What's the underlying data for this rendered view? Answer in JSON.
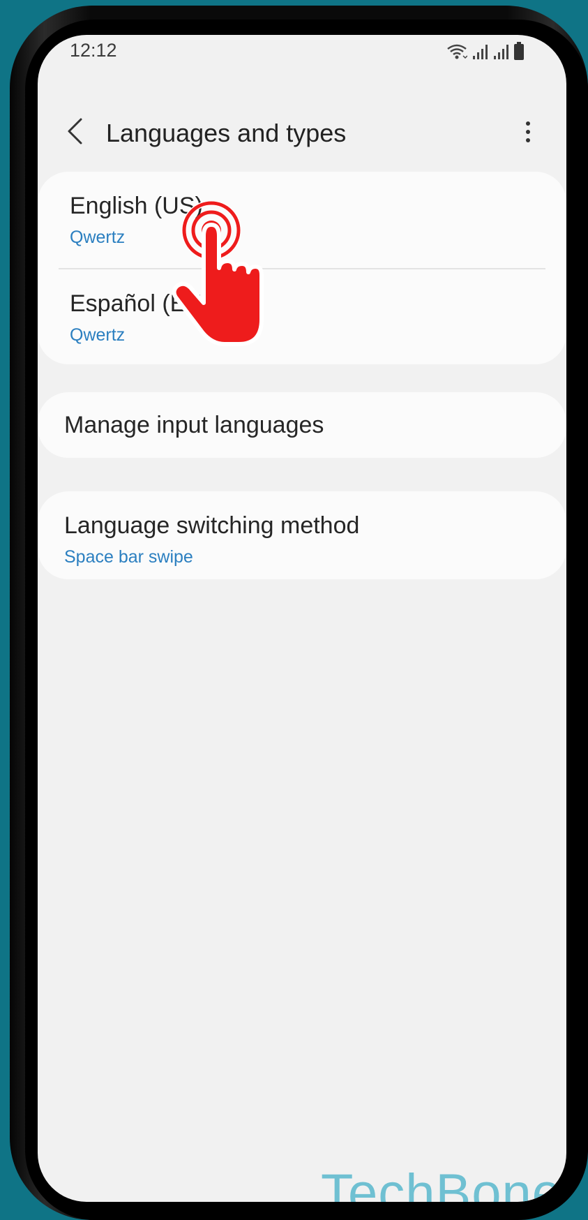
{
  "status_bar": {
    "time": "12:12"
  },
  "header": {
    "title": "Languages and types"
  },
  "languages": [
    {
      "name": "English (US)",
      "layout": "Qwertz"
    },
    {
      "name": "Español (EE. UU.)",
      "layout": "Qwertz"
    }
  ],
  "manage": {
    "label": "Manage input languages"
  },
  "switching": {
    "label": "Language switching method",
    "value": "Space bar swipe"
  },
  "watermark": {
    "text": "TechBone"
  },
  "colors": {
    "background": "#0f7486",
    "screen": "#f1f1f1",
    "card": "#fbfbfb",
    "accent_blue": "#2b7fc0",
    "tap_hand": "#ee1c1c",
    "watermark": "#6fc0d2"
  },
  "icons": {
    "back": "chevron-left-icon",
    "more": "more-vertical-icon",
    "wifi": "wifi-icon",
    "signal": "signal-icon",
    "battery": "battery-icon",
    "tap": "tap-hand-icon"
  }
}
